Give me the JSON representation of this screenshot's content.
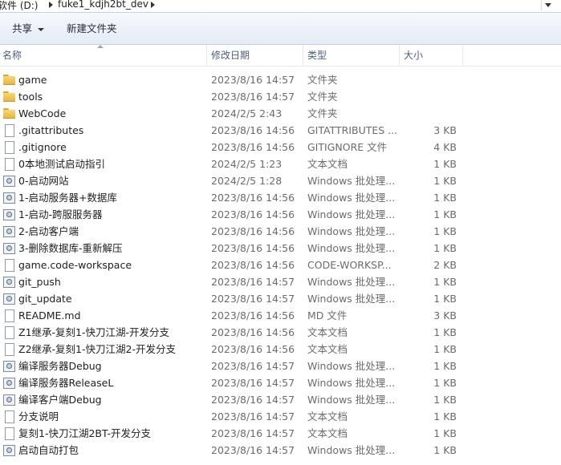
{
  "address": {
    "drive": "软件 (D:)",
    "folder": "fuke1_kdjh2bt_dev"
  },
  "toolbar": {
    "share_label": "共享",
    "new_folder_label": "新建文件夹"
  },
  "columns": {
    "name": "名称",
    "date": "修改日期",
    "type": "类型",
    "size": "大小"
  },
  "files": [
    {
      "icon": "folder-icon",
      "name": "game",
      "date": "2023/8/16 14:57",
      "type": "文件夹",
      "size": ""
    },
    {
      "icon": "folder-icon",
      "name": "tools",
      "date": "2023/8/16 14:57",
      "type": "文件夹",
      "size": ""
    },
    {
      "icon": "folder-icon",
      "name": "WebCode",
      "date": "2024/2/5 2:43",
      "type": "文件夹",
      "size": ""
    },
    {
      "icon": "file-icon",
      "name": ".gitattributes",
      "date": "2023/8/16 14:56",
      "type": "GITATTRIBUTES ...",
      "size": "3 KB"
    },
    {
      "icon": "file-icon",
      "name": ".gitignore",
      "date": "2023/8/16 14:56",
      "type": "GITIGNORE 文件",
      "size": "4 KB"
    },
    {
      "icon": "file-icon",
      "name": "0本地测试启动指引",
      "date": "2024/2/5 1:23",
      "type": "文本文档",
      "size": "1 KB"
    },
    {
      "icon": "batch-file-icon",
      "name": "0-启动网站",
      "date": "2024/2/5 1:28",
      "type": "Windows 批处理...",
      "size": "1 KB"
    },
    {
      "icon": "batch-file-icon",
      "name": "1-启动服务器+数据库",
      "date": "2023/8/16 14:56",
      "type": "Windows 批处理...",
      "size": "1 KB"
    },
    {
      "icon": "batch-file-icon",
      "name": "1-启动-跨服服务器",
      "date": "2023/8/16 14:56",
      "type": "Windows 批处理...",
      "size": "1 KB"
    },
    {
      "icon": "batch-file-icon",
      "name": "2-启动客户端",
      "date": "2023/8/16 14:56",
      "type": "Windows 批处理...",
      "size": "1 KB"
    },
    {
      "icon": "batch-file-icon",
      "name": "3-删除数据库-重新解压",
      "date": "2023/8/16 14:56",
      "type": "Windows 批处理...",
      "size": "1 KB"
    },
    {
      "icon": "file-icon",
      "name": "game.code-workspace",
      "date": "2023/8/16 14:56",
      "type": "CODE-WORKSP...",
      "size": "2 KB"
    },
    {
      "icon": "batch-file-icon",
      "name": "git_push",
      "date": "2023/8/16 14:57",
      "type": "Windows 批处理...",
      "size": "1 KB"
    },
    {
      "icon": "batch-file-icon",
      "name": "git_update",
      "date": "2023/8/16 14:57",
      "type": "Windows 批处理...",
      "size": "1 KB"
    },
    {
      "icon": "file-icon",
      "name": "README.md",
      "date": "2023/8/16 14:56",
      "type": "MD 文件",
      "size": "3 KB"
    },
    {
      "icon": "file-icon",
      "name": "Z1继承-复刻1-快刀江湖-开发分支",
      "date": "2023/8/16 14:56",
      "type": "文本文档",
      "size": "1 KB"
    },
    {
      "icon": "file-icon",
      "name": "Z2继承-复刻1-快刀江湖2-开发分支",
      "date": "2023/8/16 14:56",
      "type": "文本文档",
      "size": "1 KB"
    },
    {
      "icon": "batch-file-icon",
      "name": "编译服务器Debug",
      "date": "2023/8/16 14:57",
      "type": "Windows 批处理...",
      "size": "1 KB"
    },
    {
      "icon": "batch-file-icon",
      "name": "编译服务器ReleaseL",
      "date": "2023/8/16 14:57",
      "type": "Windows 批处理...",
      "size": "1 KB"
    },
    {
      "icon": "batch-file-icon",
      "name": "编译客户端Debug",
      "date": "2023/8/16 14:57",
      "type": "Windows 批处理...",
      "size": "1 KB"
    },
    {
      "icon": "file-icon",
      "name": "分支说明",
      "date": "2023/8/16 14:57",
      "type": "文本文档",
      "size": "1 KB"
    },
    {
      "icon": "file-icon",
      "name": "复刻1-快刀江湖2BT-开发分支",
      "date": "2023/8/16 14:57",
      "type": "文本文档",
      "size": "1 KB"
    },
    {
      "icon": "batch-file-icon",
      "name": "启动自动打包",
      "date": "2023/8/16 14:57",
      "type": "Windows 批处理...",
      "size": "1 KB"
    }
  ]
}
